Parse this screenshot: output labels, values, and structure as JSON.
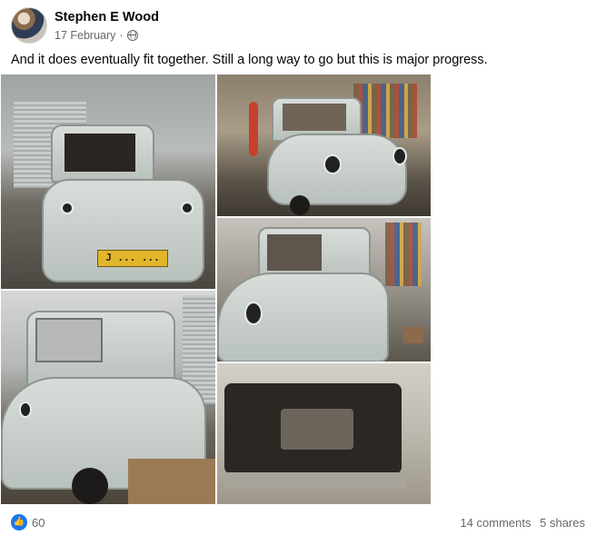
{
  "post": {
    "author": "Stephen E Wood",
    "date": "17 February",
    "separator": "·",
    "privacy_icon": "globe-icon",
    "text": "And it does eventually fit together. Still a long way to go but this is major progress.",
    "plate_text": "J ... ..."
  },
  "photos": [
    {
      "id": "rear-view-garage"
    },
    {
      "id": "front-view-workshop"
    },
    {
      "id": "front-three-quarter"
    },
    {
      "id": "rear-three-quarter"
    },
    {
      "id": "engine-bay"
    }
  ],
  "footer": {
    "reaction_icon": "like-icon",
    "reaction_count": "60",
    "comments": "14 comments",
    "shares": "5 shares"
  },
  "colors": {
    "like_blue": "#1877f2",
    "secondary_text": "#65676b"
  }
}
